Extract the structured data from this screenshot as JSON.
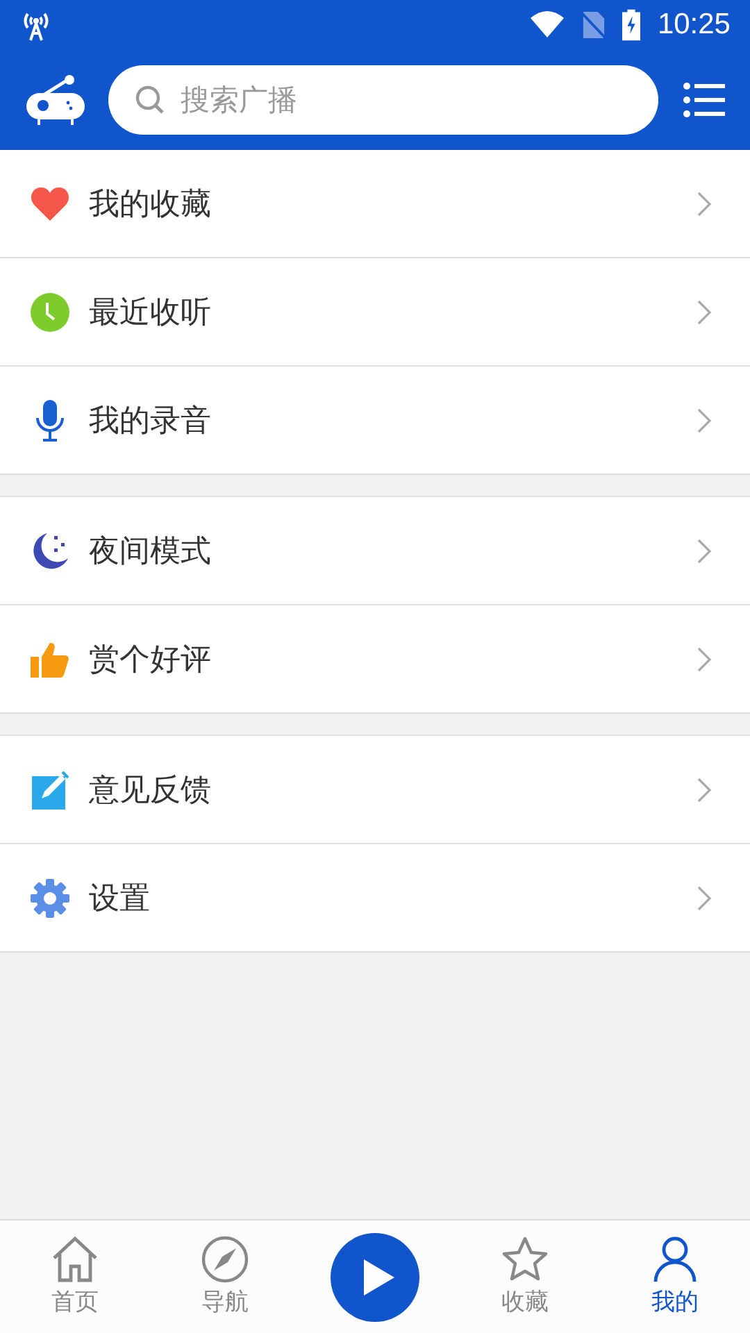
{
  "status_bar": {
    "time": "10:25"
  },
  "header": {
    "search": {
      "placeholder": "搜索广播"
    }
  },
  "menu_groups": [
    {
      "items": [
        {
          "kind": "heart",
          "label": "我的收藏"
        },
        {
          "kind": "clock",
          "label": "最近收听"
        },
        {
          "kind": "mic",
          "label": "我的录音"
        }
      ]
    },
    {
      "items": [
        {
          "kind": "moon",
          "label": "夜间模式"
        },
        {
          "kind": "thumb",
          "label": "赏个好评"
        }
      ]
    },
    {
      "items": [
        {
          "kind": "edit",
          "label": "意见反馈"
        },
        {
          "kind": "gear",
          "label": "设置"
        }
      ]
    }
  ],
  "bottom_nav": {
    "tabs": [
      {
        "kind": "home",
        "label": "首页",
        "selected": false
      },
      {
        "kind": "compass",
        "label": "导航",
        "selected": false
      },
      {
        "kind": "star",
        "label": "收藏",
        "selected": false
      },
      {
        "kind": "person",
        "label": "我的",
        "selected": true
      }
    ]
  }
}
